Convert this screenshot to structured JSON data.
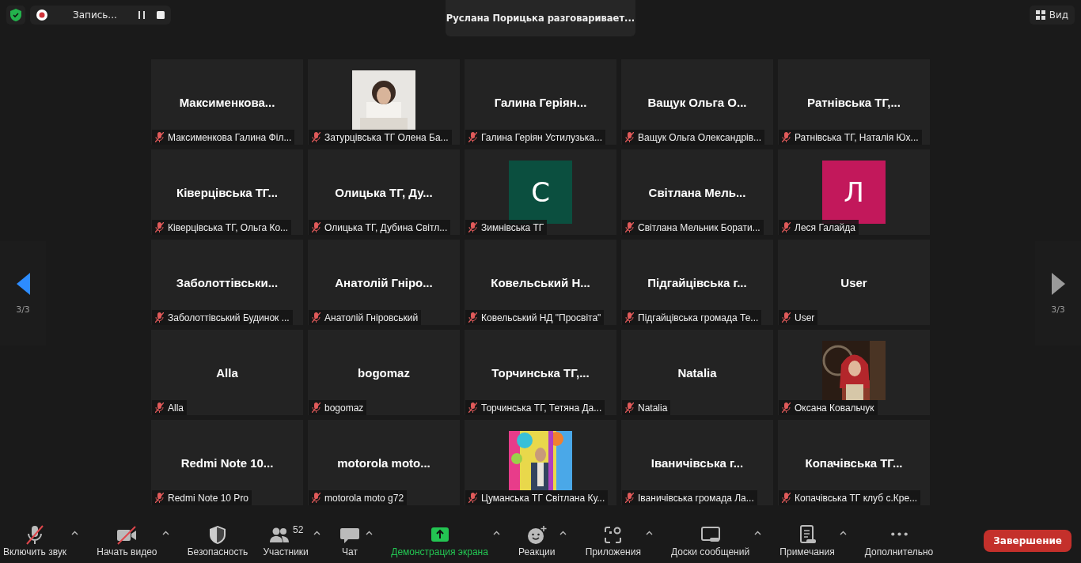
{
  "top_bar": {
    "recording": {
      "label": "Запись..."
    },
    "speaker_notice": "Руслана Порицька разговаривает...",
    "view_button": "Вид"
  },
  "pager": {
    "left": {
      "page": "3/3",
      "disabled": false
    },
    "right": {
      "page": "3/3",
      "disabled": true
    }
  },
  "tiles": [
    {
      "kind": "name",
      "display": "Максименкова...",
      "label": "Максименкова Галина Філ..."
    },
    {
      "kind": "picture",
      "label": "Затурцівська ТГ Олена Ба..."
    },
    {
      "kind": "name",
      "display": "Галина  Геріян...",
      "label": "Галина Геріян Устилузька..."
    },
    {
      "kind": "name",
      "display": "Ващук Ольга О...",
      "label": "Ващук Ольга Олександрів..."
    },
    {
      "kind": "name",
      "display": "Ратнівська ТГ,...",
      "label": "Ратнівська ТГ, Наталія Юх..."
    },
    {
      "kind": "name",
      "display": "Ківерцівська ТГ...",
      "label": "Ківерцівська ТГ, Ольга Ко..."
    },
    {
      "kind": "name",
      "display": "Олицька ТГ, Ду...",
      "label": "Олицька ТГ, Дубина Світл..."
    },
    {
      "kind": "letter",
      "display": "С",
      "color": "#0b4f3f",
      "label": "Зимнівська ТГ"
    },
    {
      "kind": "name",
      "display": "Світлана  Мель...",
      "label": "Світлана Мельник Борати..."
    },
    {
      "kind": "letter",
      "display": "Л",
      "color": "#c2185b",
      "label": "Леся Галайда"
    },
    {
      "kind": "name",
      "display": "Заболоттівськи...",
      "label": "Заболоттівський Будинок ..."
    },
    {
      "kind": "name",
      "display": "Анатолій Гніро...",
      "label": "Анатолій Гніровський"
    },
    {
      "kind": "name",
      "display": "Ковельський  Н...",
      "label": "Ковельський НД \"Просвіта\""
    },
    {
      "kind": "name",
      "display": "Підгайцівська  г...",
      "label": "Підгайцівська громада Те..."
    },
    {
      "kind": "name",
      "display": "User",
      "label": "User"
    },
    {
      "kind": "name",
      "display": "Alla",
      "label": "Alla"
    },
    {
      "kind": "name",
      "display": "bogomaz",
      "label": "bogomaz"
    },
    {
      "kind": "name",
      "display": "Торчинська  ТГ,...",
      "label": "Торчинська ТГ, Тетяна Да..."
    },
    {
      "kind": "name",
      "display": "Natalia",
      "label": "Natalia"
    },
    {
      "kind": "picture",
      "label": "Оксана Ковальчук"
    },
    {
      "kind": "name",
      "display": "Redmi Note 10...",
      "label": "Redmi Note 10 Pro"
    },
    {
      "kind": "name",
      "display": "motorola  moto...",
      "label": "motorola moto g72"
    },
    {
      "kind": "picture",
      "label": "Цуманська ТГ Світлана Ку..."
    },
    {
      "kind": "name",
      "display": "Іваничівська  г...",
      "label": "Іваничівська  громада  Ла..."
    },
    {
      "kind": "name",
      "display": "Копачівська ТГ...",
      "label": "Копачівська ТГ клуб с.Кре..."
    }
  ],
  "toolbar": [
    {
      "label": "Включить звук",
      "menu": true,
      "highlighted": false
    },
    {
      "label": "Начать видео",
      "menu": true,
      "highlighted": false
    },
    {
      "label": "Безопасность",
      "menu": false,
      "highlighted": false
    },
    {
      "label": "Участники",
      "count": "52",
      "menu": true,
      "highlighted": false
    },
    {
      "label": "Чат",
      "menu": true,
      "highlighted": false
    },
    {
      "label": "Демонстрация экрана",
      "menu": true,
      "highlighted": true
    },
    {
      "label": "Реакции",
      "menu": true,
      "highlighted": false
    },
    {
      "label": "Приложения",
      "menu": true,
      "highlighted": false
    },
    {
      "label": "Доски сообщений",
      "menu": true,
      "highlighted": false
    },
    {
      "label": "Примечания",
      "menu": true,
      "highlighted": false
    },
    {
      "label": "Дополнительно",
      "menu": false,
      "highlighted": false
    }
  ],
  "end_button": "Завершение"
}
